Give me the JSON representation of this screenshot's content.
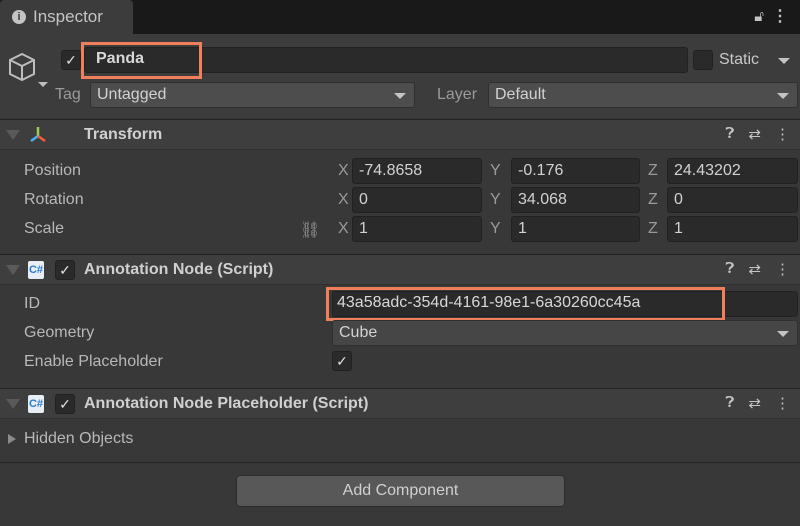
{
  "tab": {
    "title": "Inspector",
    "icon": "info-icon"
  },
  "header": {
    "active": true,
    "name": "Panda",
    "static_label": "Static",
    "static_checked": false,
    "tag_label": "Tag",
    "tag_value": "Untagged",
    "layer_label": "Layer",
    "layer_value": "Default"
  },
  "transform": {
    "title": "Transform",
    "rows": [
      {
        "label": "Position",
        "x": "-74.8658",
        "y": "-0.176",
        "z": "24.43202"
      },
      {
        "label": "Rotation",
        "x": "0",
        "y": "34.068",
        "z": "0"
      },
      {
        "label": "Scale",
        "x": "1",
        "y": "1",
        "z": "1"
      }
    ],
    "axes": {
      "x": "X",
      "y": "Y",
      "z": "Z"
    }
  },
  "annotation_node": {
    "title": "Annotation Node (Script)",
    "enabled": true,
    "id_label": "ID",
    "id_value": "43a58adc-354d-4161-98e1-6a30260cc45a",
    "geometry_label": "Geometry",
    "geometry_value": "Cube",
    "placeholder_label": "Enable Placeholder",
    "placeholder_checked": true
  },
  "placeholder": {
    "title": "Annotation Node Placeholder (Script)",
    "enabled": true,
    "hidden_label": "Hidden Objects"
  },
  "add_component": "Add Component",
  "check": "✓",
  "colors": {
    "highlight": "#f07f5c"
  }
}
